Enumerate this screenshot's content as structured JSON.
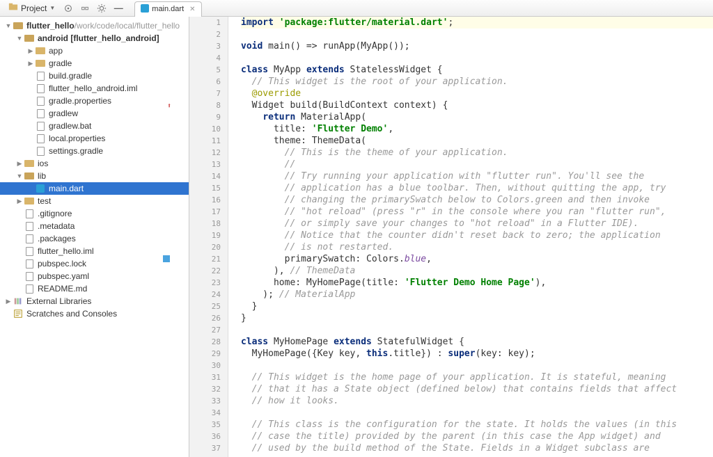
{
  "toolbar": {
    "project_label": "Project"
  },
  "tab": {
    "label": "main.dart"
  },
  "tree": [
    {
      "d": 0,
      "tw": "▼",
      "ic": "folder",
      "label": "flutter_hello",
      "suffix": " /work/code/local/flutter_hello",
      "bold": true
    },
    {
      "d": 1,
      "tw": "▼",
      "ic": "folder",
      "label": "android [flutter_hello_android]",
      "bold": true
    },
    {
      "d": 2,
      "tw": "▶",
      "ic": "folder",
      "label": "app"
    },
    {
      "d": 2,
      "tw": "▶",
      "ic": "folder",
      "label": "gradle"
    },
    {
      "d": 2,
      "tw": "",
      "ic": "file",
      "label": "build.gradle"
    },
    {
      "d": 2,
      "tw": "",
      "ic": "file",
      "label": "flutter_hello_android.iml"
    },
    {
      "d": 2,
      "tw": "",
      "ic": "file",
      "label": "gradle.properties"
    },
    {
      "d": 2,
      "tw": "",
      "ic": "file",
      "label": "gradlew"
    },
    {
      "d": 2,
      "tw": "",
      "ic": "file",
      "label": "gradlew.bat"
    },
    {
      "d": 2,
      "tw": "",
      "ic": "file",
      "label": "local.properties"
    },
    {
      "d": 2,
      "tw": "",
      "ic": "file",
      "label": "settings.gradle"
    },
    {
      "d": 1,
      "tw": "▶",
      "ic": "folder",
      "label": "ios"
    },
    {
      "d": 1,
      "tw": "▼",
      "ic": "folder",
      "label": "lib"
    },
    {
      "d": 2,
      "tw": "",
      "ic": "dart",
      "label": "main.dart",
      "selected": true
    },
    {
      "d": 1,
      "tw": "▶",
      "ic": "folder",
      "label": "test"
    },
    {
      "d": 1,
      "tw": "",
      "ic": "file",
      "label": ".gitignore"
    },
    {
      "d": 1,
      "tw": "",
      "ic": "file",
      "label": ".metadata"
    },
    {
      "d": 1,
      "tw": "",
      "ic": "file",
      "label": ".packages"
    },
    {
      "d": 1,
      "tw": "",
      "ic": "file",
      "label": "flutter_hello.iml"
    },
    {
      "d": 1,
      "tw": "",
      "ic": "file",
      "label": "pubspec.lock"
    },
    {
      "d": 1,
      "tw": "",
      "ic": "file",
      "label": "pubspec.yaml"
    },
    {
      "d": 1,
      "tw": "",
      "ic": "file",
      "label": "README.md"
    },
    {
      "d": 0,
      "tw": "▶",
      "ic": "lib",
      "label": "External Libraries"
    },
    {
      "d": 0,
      "tw": "",
      "ic": "scratch",
      "label": "Scratches and Consoles"
    }
  ],
  "code": [
    {
      "n": 1,
      "hl": true,
      "t": [
        {
          "c": "kw",
          "s": "import"
        },
        {
          "s": " "
        },
        {
          "c": "str",
          "s": "'package:flutter/material.dart'"
        },
        {
          "s": ";"
        }
      ]
    },
    {
      "n": 2,
      "t": []
    },
    {
      "n": 3,
      "t": [
        {
          "c": "kw",
          "s": "void"
        },
        {
          "s": " main() => runApp(MyApp());"
        }
      ]
    },
    {
      "n": 4,
      "t": []
    },
    {
      "n": 5,
      "t": [
        {
          "c": "kw",
          "s": "class"
        },
        {
          "s": " MyApp "
        },
        {
          "c": "kw",
          "s": "extends"
        },
        {
          "s": " StatelessWidget {"
        }
      ]
    },
    {
      "n": 6,
      "t": [
        {
          "s": "  "
        },
        {
          "c": "cmt",
          "s": "// This widget is the root of your application."
        }
      ]
    },
    {
      "n": 7,
      "t": [
        {
          "s": "  "
        },
        {
          "c": "ann",
          "s": "@override"
        }
      ]
    },
    {
      "n": 8,
      "arrow": true,
      "t": [
        {
          "s": "  Widget build(BuildContext context) {"
        }
      ]
    },
    {
      "n": 9,
      "t": [
        {
          "s": "    "
        },
        {
          "c": "kw",
          "s": "return"
        },
        {
          "s": " MaterialApp("
        }
      ]
    },
    {
      "n": 10,
      "t": [
        {
          "s": "      title: "
        },
        {
          "c": "str",
          "s": "'Flutter Demo'"
        },
        {
          "s": ","
        }
      ]
    },
    {
      "n": 11,
      "t": [
        {
          "s": "      theme: ThemeData("
        }
      ]
    },
    {
      "n": 12,
      "t": [
        {
          "s": "        "
        },
        {
          "c": "cmt",
          "s": "// This is the theme of your application."
        }
      ]
    },
    {
      "n": 13,
      "t": [
        {
          "s": "        "
        },
        {
          "c": "cmt",
          "s": "//"
        }
      ]
    },
    {
      "n": 14,
      "t": [
        {
          "s": "        "
        },
        {
          "c": "cmt",
          "s": "// Try running your application with \"flutter run\". You'll see the"
        }
      ]
    },
    {
      "n": 15,
      "t": [
        {
          "s": "        "
        },
        {
          "c": "cmt",
          "s": "// application has a blue toolbar. Then, without quitting the app, try"
        }
      ]
    },
    {
      "n": 16,
      "t": [
        {
          "s": "        "
        },
        {
          "c": "cmt",
          "s": "// changing the primarySwatch below to Colors.green and then invoke"
        }
      ]
    },
    {
      "n": 17,
      "t": [
        {
          "s": "        "
        },
        {
          "c": "cmt",
          "s": "// \"hot reload\" (press \"r\" in the console where you ran \"flutter run\","
        }
      ]
    },
    {
      "n": 18,
      "t": [
        {
          "s": "        "
        },
        {
          "c": "cmt",
          "s": "// or simply save your changes to \"hot reload\" in a Flutter IDE)."
        }
      ]
    },
    {
      "n": 19,
      "t": [
        {
          "s": "        "
        },
        {
          "c": "cmt",
          "s": "// Notice that the counter didn't reset back to zero; the application"
        }
      ]
    },
    {
      "n": 20,
      "t": [
        {
          "s": "        "
        },
        {
          "c": "cmt",
          "s": "// is not restarted."
        }
      ]
    },
    {
      "n": 21,
      "box": true,
      "t": [
        {
          "s": "        primarySwatch: Colors."
        },
        {
          "c": "ident",
          "s": "blue"
        },
        {
          "s": ","
        }
      ]
    },
    {
      "n": 22,
      "t": [
        {
          "s": "      ), "
        },
        {
          "c": "cmt",
          "s": "// ThemeData"
        }
      ]
    },
    {
      "n": 23,
      "t": [
        {
          "s": "      home: MyHomePage(title: "
        },
        {
          "c": "str",
          "s": "'Flutter Demo Home Page'"
        },
        {
          "s": "),"
        }
      ]
    },
    {
      "n": 24,
      "t": [
        {
          "s": "    ); "
        },
        {
          "c": "cmt",
          "s": "// MaterialApp"
        }
      ]
    },
    {
      "n": 25,
      "t": [
        {
          "s": "  }"
        }
      ]
    },
    {
      "n": 26,
      "t": [
        {
          "s": "}"
        }
      ]
    },
    {
      "n": 27,
      "t": []
    },
    {
      "n": 28,
      "t": [
        {
          "c": "kw",
          "s": "class"
        },
        {
          "s": " MyHomePage "
        },
        {
          "c": "kw",
          "s": "extends"
        },
        {
          "s": " StatefulWidget {"
        }
      ]
    },
    {
      "n": 29,
      "t": [
        {
          "s": "  MyHomePage({Key key, "
        },
        {
          "c": "kw",
          "s": "this"
        },
        {
          "s": ".title}) : "
        },
        {
          "c": "kw",
          "s": "super"
        },
        {
          "s": "(key: key);"
        }
      ]
    },
    {
      "n": 30,
      "t": []
    },
    {
      "n": 31,
      "t": [
        {
          "s": "  "
        },
        {
          "c": "cmt",
          "s": "// This widget is the home page of your application. It is stateful, meaning"
        }
      ]
    },
    {
      "n": 32,
      "t": [
        {
          "s": "  "
        },
        {
          "c": "cmt",
          "s": "// that it has a State object (defined below) that contains fields that affect"
        }
      ]
    },
    {
      "n": 33,
      "t": [
        {
          "s": "  "
        },
        {
          "c": "cmt",
          "s": "// how it looks."
        }
      ]
    },
    {
      "n": 34,
      "t": []
    },
    {
      "n": 35,
      "t": [
        {
          "s": "  "
        },
        {
          "c": "cmt",
          "s": "// This class is the configuration for the state. It holds the values (in this"
        }
      ]
    },
    {
      "n": 36,
      "t": [
        {
          "s": "  "
        },
        {
          "c": "cmt",
          "s": "// case the title) provided by the parent (in this case the App widget) and"
        }
      ]
    },
    {
      "n": 37,
      "t": [
        {
          "s": "  "
        },
        {
          "c": "cmt",
          "s": "// used by the build method of the State. Fields in a Widget subclass are"
        }
      ]
    }
  ]
}
